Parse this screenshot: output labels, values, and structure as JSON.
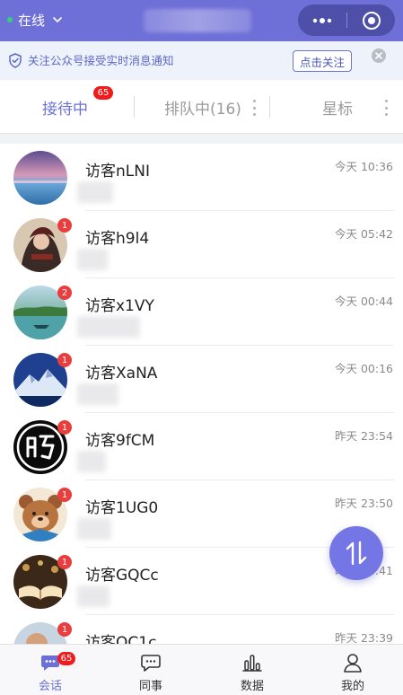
{
  "header": {
    "status_label": "在线",
    "status_color": "#35d07a",
    "bar_color": "#6f6fd8",
    "title": ""
  },
  "notice": {
    "text": "关注公众号接受实时消息通知",
    "follow_label": "点击关注",
    "icon": "shield-check-icon"
  },
  "tabs": [
    {
      "label": "接待中",
      "badge": "65",
      "active": true
    },
    {
      "label": "排队中(16)",
      "active": false
    },
    {
      "label": "星标",
      "active": false
    }
  ],
  "conversations": [
    {
      "name": "访客nLNI",
      "time": "今天 10:36",
      "unread": "",
      "avatar": "sunset-sea-avatar"
    },
    {
      "name": "访客h9l4",
      "time": "今天 05:42",
      "unread": "1",
      "avatar": "anime-character-avatar"
    },
    {
      "name": "访客x1VY",
      "time": "今天 00:44",
      "unread": "2",
      "avatar": "lake-landscape-avatar"
    },
    {
      "name": "访客XaNA",
      "time": "今天 00:16",
      "unread": "1",
      "avatar": "snow-mountain-avatar"
    },
    {
      "name": "访客9fCM",
      "time": "昨天 23:54",
      "unread": "1",
      "avatar": "calligraphy-logo-avatar"
    },
    {
      "name": "访客1UG0",
      "time": "昨天 23:50",
      "unread": "1",
      "avatar": "cartoon-bear-avatar"
    },
    {
      "name": "访客GQCc",
      "time": "昨天 23:41",
      "unread": "1",
      "avatar": "open-book-avatar"
    },
    {
      "name": "访客OC1c",
      "time": "昨天 23:39",
      "unread": "1",
      "avatar": "person-avatar"
    }
  ],
  "bottom_nav": [
    {
      "label": "会话",
      "icon": "chat-bubble-icon",
      "badge": "65",
      "active": true
    },
    {
      "label": "同事",
      "icon": "message-square-icon",
      "active": false
    },
    {
      "label": "数据",
      "icon": "bar-chart-icon",
      "active": false
    },
    {
      "label": "我的",
      "icon": "user-icon",
      "active": false
    }
  ],
  "fab_icon": "sort-arrows-icon",
  "accent_color": "#6c6fd6",
  "badge_color": "#ee1c1c"
}
